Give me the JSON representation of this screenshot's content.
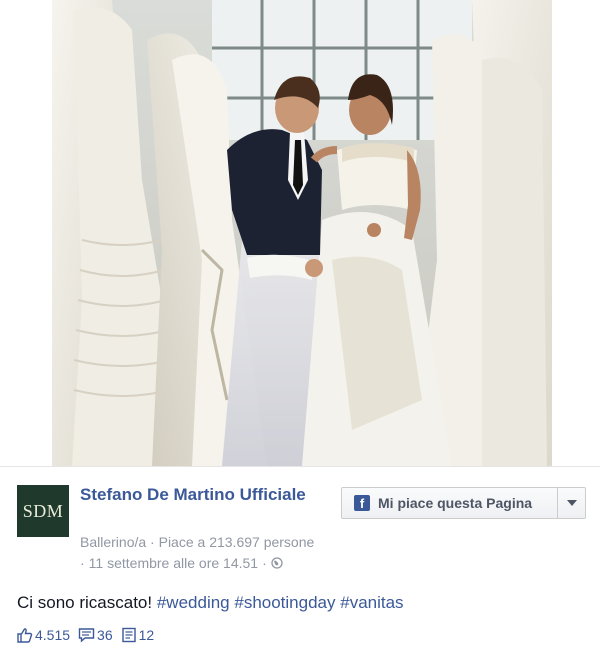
{
  "post": {
    "page_name": "Stefano De Martino Ufficiale",
    "logo_text": "SDM",
    "category": "Ballerino/a",
    "likes_line": "Piace a 213.697 persone",
    "timestamp": "11 settembre alle ore 14.51",
    "like_page_button": "Mi piace questa Pagina",
    "text_prefix": "Ci sono ricascato! ",
    "hashtags": [
      "#wedding",
      "#shootingday",
      "#vanitas"
    ],
    "likes_count": "4.515",
    "comments_count": "36",
    "shares_count": "12"
  },
  "colors": {
    "link_blue": "#3b5998",
    "meta_gray": "#9197a3",
    "logo_bg": "#1f3a2c"
  },
  "icons": {
    "like": "thumbs-up-icon",
    "comment": "comment-icon",
    "share": "share-icon",
    "privacy": "globe-icon",
    "facebook": "facebook-icon",
    "dropdown": "chevron-down-icon"
  }
}
